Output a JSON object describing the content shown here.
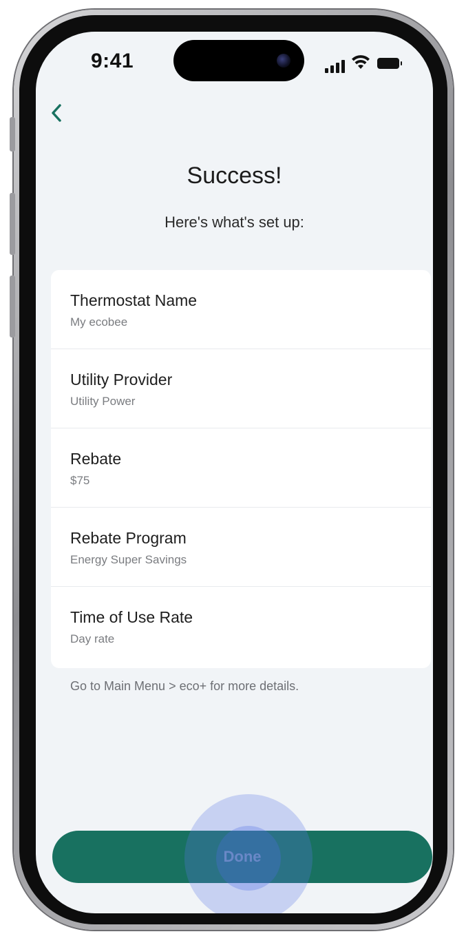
{
  "status_bar": {
    "time": "9:41"
  },
  "header": {
    "back_icon": "chevron-left-icon",
    "title": "Success!",
    "subtitle": "Here's what's set up:"
  },
  "summary": {
    "items": [
      {
        "label": "Thermostat Name",
        "value": "My ecobee"
      },
      {
        "label": "Utility Provider",
        "value": "Utility Power"
      },
      {
        "label": "Rebate",
        "value": "$75"
      },
      {
        "label": "Rebate Program",
        "value": "Energy Super Savings"
      },
      {
        "label": "Time of Use Rate",
        "value": "Day rate"
      }
    ],
    "footnote": "Go to Main Menu > eco+ for more details."
  },
  "actions": {
    "done_label": "Done"
  },
  "colors": {
    "accent": "#187160",
    "background": "#f1f4f7",
    "card": "#ffffff",
    "touch_indicator": "#5a78e6"
  }
}
